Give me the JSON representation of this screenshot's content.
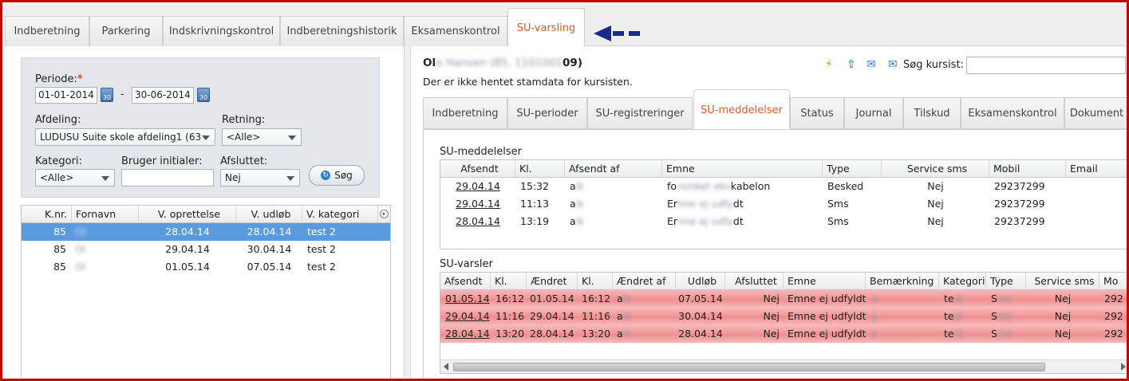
{
  "top_tabs": [
    {
      "label": "Indberetning"
    },
    {
      "label": "Parkering"
    },
    {
      "label": "Indskrivningskontrol"
    },
    {
      "label": "Indberetningshistorik"
    },
    {
      "label": "Eksamenskontrol"
    },
    {
      "label": "SU-varsling",
      "active": true
    }
  ],
  "filter": {
    "periode_label": "Periode:",
    "required_mark": "*",
    "date_from": "01-01-2014",
    "date_sep": "-",
    "date_to": "30-06-2014",
    "calendar_glyph": "30",
    "afdeling_label": "Afdeling:",
    "afdeling_value": "LUDUSU Suite skole afdeling1 (63",
    "retning_label": "Retning:",
    "retning_value": "<Alle>",
    "kategori_label": "Kategori:",
    "kategori_value": "<Alle>",
    "bruger_label": "Bruger initialer:",
    "bruger_value": "",
    "afsluttet_label": "Afsluttet:",
    "afsluttet_value": "Nej",
    "search_button": "Søg"
  },
  "left_grid": {
    "columns": [
      "K.nr.",
      "Fornavn",
      "V. oprettelse",
      "V. udløb",
      "V. kategori"
    ],
    "rows": [
      {
        "knr": "85",
        "fornavn": "Ol",
        "oprettelse": "28.04.14",
        "udlob": "28.04.14",
        "kategori": "test 2",
        "selected": true
      },
      {
        "knr": "85",
        "fornavn": "Ol",
        "oprettelse": "29.04.14",
        "udlob": "30.04.14",
        "kategori": "test 2"
      },
      {
        "knr": "85",
        "fornavn": "Ol",
        "oprettelse": "01.05.14",
        "udlob": "07.05.14",
        "kategori": "test 2"
      }
    ]
  },
  "student": {
    "name_visible_start": "Ol",
    "name_blurred": "e Hansen (85, 1101001",
    "name_visible_end": "09)",
    "note": "Der er ikke hentet stamdata for kursisten."
  },
  "toolbar": {
    "search_label": "Søg kursist:",
    "search_value": ""
  },
  "sub_tabs": [
    {
      "label": "Indberetning"
    },
    {
      "label": "SU-perioder"
    },
    {
      "label": "SU-registreringer"
    },
    {
      "label": "SU-meddelelser",
      "active": true
    },
    {
      "label": "Status"
    },
    {
      "label": "Journal"
    },
    {
      "label": "Tilskud"
    },
    {
      "label": "Eksamenskontrol"
    },
    {
      "label": "Dokument"
    }
  ],
  "meddelelser": {
    "title": "SU-meddelelser",
    "columns": [
      "Afsendt",
      "Kl.",
      "Afsendt af",
      "Emne",
      "Type",
      "Service sms",
      "Mobil",
      "Email"
    ],
    "rows": [
      {
        "afsendt": "29.04.14",
        "kl": "15:32",
        "af": "a",
        "emne_start": "fo",
        "emne_blur": "rsinket eks",
        "emne_end": "kabelon",
        "type": "Besked",
        "sms": "Nej",
        "mobil": "29237299",
        "email": ""
      },
      {
        "afsendt": "29.04.14",
        "kl": "11:13",
        "af": "a",
        "emne_start": "Er",
        "emne_blur": "nne ej udfy",
        "emne_end": "dt",
        "type": "Sms",
        "sms": "Nej",
        "mobil": "29237299",
        "email": ""
      },
      {
        "afsendt": "28.04.14",
        "kl": "13:19",
        "af": "a",
        "emne_start": "Er",
        "emne_blur": "nne ej udfy",
        "emne_end": "dt",
        "type": "Sms",
        "sms": "Nej",
        "mobil": "29237299",
        "email": ""
      }
    ]
  },
  "varsler": {
    "title": "SU-varsler",
    "columns": [
      "Afsendt",
      "Kl.",
      "Ændret",
      "Kl.",
      "Ændret af",
      "Udløb",
      "Afsluttet",
      "Emne",
      "Bemærkning",
      "Kategori",
      "Type",
      "Service sms",
      "Mo"
    ],
    "rows": [
      {
        "afsendt": "01.05.14",
        "kl": "16:12",
        "aendret": "01.05.14",
        "kl2": "16:12",
        "af": "a",
        "udlob": "07.05.14",
        "afsluttet": "Nej",
        "emne": "Emne ej udfyldt",
        "bem": "e",
        "kat": "te",
        "type": "S",
        "sms": "Nej",
        "mo": "292"
      },
      {
        "afsendt": "29.04.14",
        "kl": "11:16",
        "aendret": "29.04.14",
        "kl2": "11:16",
        "af": "a",
        "udlob": "30.04.14",
        "afsluttet": "Nej",
        "emne": "Emne ej udfyldt",
        "bem": "p",
        "kat": "te",
        "type": "S",
        "sms": "Nej",
        "mo": "292"
      },
      {
        "afsendt": "28.04.14",
        "kl": "13:20",
        "aendret": "28.04.14",
        "kl2": "13:20",
        "af": "a",
        "udlob": "28.04.14",
        "afsluttet": "Nej",
        "emne": "Emne ej udfyldt",
        "bem": "e",
        "kat": "te",
        "type": "S",
        "sms": "Nej",
        "mo": "292"
      }
    ]
  },
  "colors": {
    "frame": "#c40000",
    "active_tab_text": "#e0582b",
    "selected_row": "#5a9be0",
    "warning_row": "#f08f8f",
    "arrow": "#1a2a8a"
  }
}
